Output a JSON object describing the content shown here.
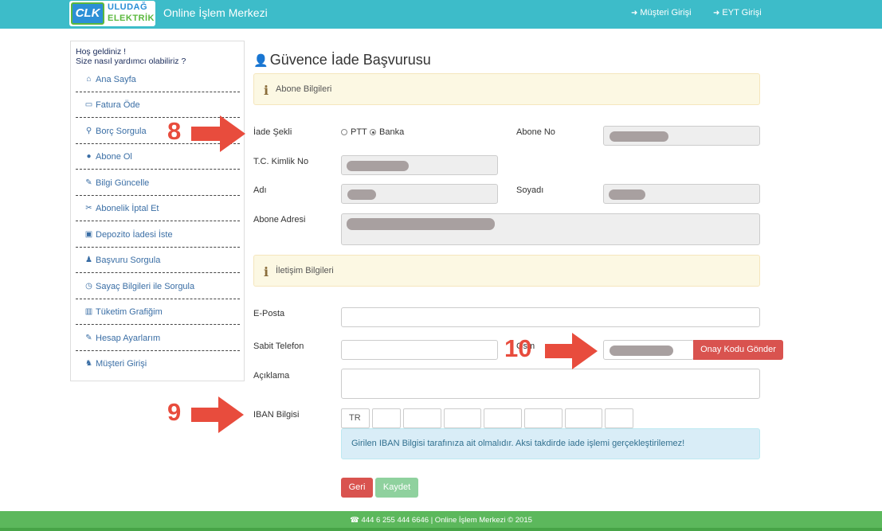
{
  "header": {
    "logo_clk": "CLK",
    "logo_line1": "ULUDAĞ",
    "logo_line2": "ELEKTRİK",
    "app_title": "Online İşlem Merkezi",
    "links": [
      {
        "label": "Müşteri Girişi",
        "icon": "sign-in-icon"
      },
      {
        "label": "EYT Girişi",
        "icon": "sign-in-icon"
      }
    ]
  },
  "sidebar": {
    "welcome_line1": "Hoş geldiniz !",
    "welcome_line2": "Size nasıl yardımcı olabiliriz ?",
    "items": [
      {
        "label": "Ana Sayfa",
        "icon": "home-icon"
      },
      {
        "label": "Fatura Öde",
        "icon": "credit-card-icon"
      },
      {
        "label": "Borç Sorgula",
        "icon": "search-icon"
      },
      {
        "label": "Abone Ol",
        "icon": "globe-icon"
      },
      {
        "label": "Bilgi Güncelle",
        "icon": "edit-icon"
      },
      {
        "label": "Abonelik İptal Et",
        "icon": "scissors-icon"
      },
      {
        "label": "Depozito İadesi İste",
        "icon": "money-icon"
      },
      {
        "label": "Başvuru Sorgula",
        "icon": "user-plus-icon"
      },
      {
        "label": "Sayaç Bilgileri ile Sorgula",
        "icon": "clock-icon"
      },
      {
        "label": "Tüketim Grafiğim",
        "icon": "bar-chart-icon"
      },
      {
        "label": "Hesap Ayarlarım",
        "icon": "edit-icon"
      },
      {
        "label": "Müşteri Girişi",
        "icon": "users-icon"
      }
    ]
  },
  "main": {
    "title": "Güvence İade Başvurusu",
    "section1": "Abone Bilgileri",
    "section2": "İletişim Bilgileri",
    "labels": {
      "iade_sekli": "İade Şekli",
      "abone_no": "Abone No",
      "tc": "T.C. Kimlik No",
      "adi": "Adı",
      "soyadi": "Soyadı",
      "adres": "Abone Adresi",
      "eposta": "E-Posta",
      "sabit_tel": "Sabit Telefon",
      "gsm": "Gsm",
      "aciklama": "Açıklama",
      "iban": "IBAN Bilgisi"
    },
    "radio_ptt": "PTT",
    "radio_banka": "Banka",
    "radio_selected": "Banka",
    "onay_button": "Onay Kodu Gönder",
    "iban_prefix": "TR",
    "iban_info": "Girilen IBAN Bilgisi tarafınıza ait olmalıdır. Aksi takdirde iade işlemi gerçekleştirilemez!",
    "back_button": "Geri",
    "save_button": "Kaydet"
  },
  "annotations": {
    "n8": "8",
    "n9": "9",
    "n10": "10"
  },
  "footer": {
    "text": "☎ 444 6 255 444 6646 | Online İşlem Merkezi © 2015"
  },
  "colors": {
    "header": "#3dbcc9",
    "footer": "#5cb85c",
    "danger": "#d9534f",
    "success_disabled": "#8fd19e",
    "arrow": "#e84c3d"
  }
}
